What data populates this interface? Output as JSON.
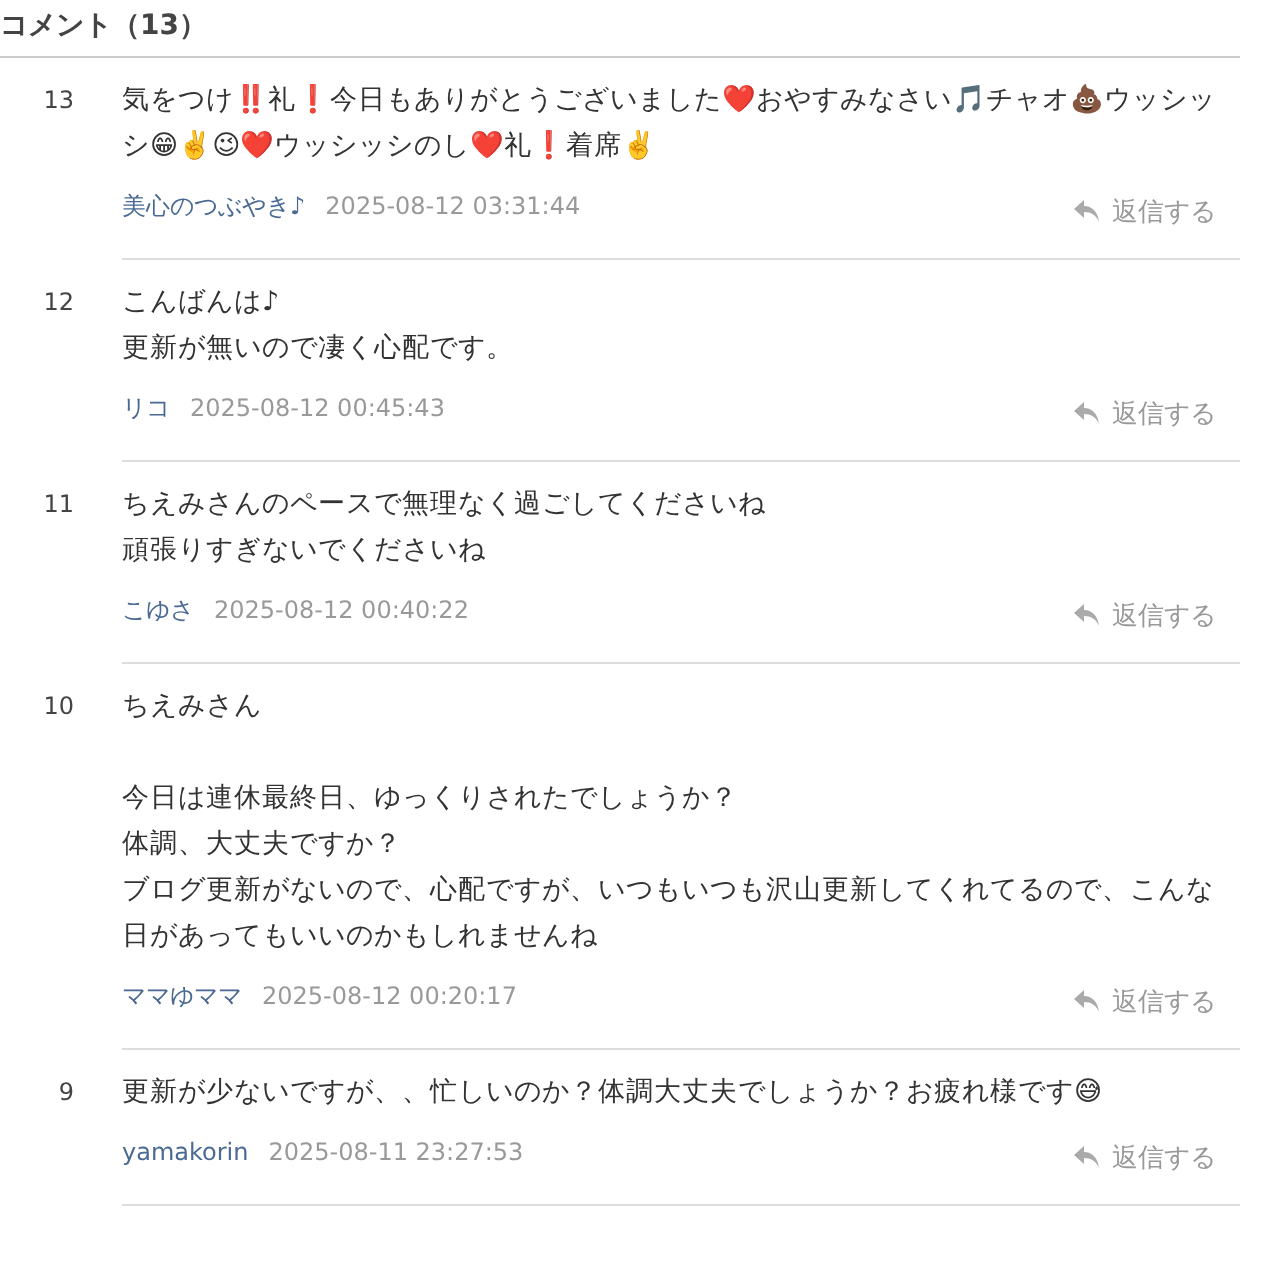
{
  "header": {
    "title": "コメント（13）"
  },
  "comments": [
    {
      "number": "13",
      "paragraphs": [
        [
          "気をつけ‼️礼❗今日もありがとうございました❤️おやすみなさい🎵チャオ💩ウッシッシ😁✌️😉❤️ウッシッシのし❤️礼❗着席✌️"
        ]
      ],
      "author": "美心のつぶやき♪",
      "date": "2025-08-12 03:31:44",
      "reply": "返信する"
    },
    {
      "number": "12",
      "paragraphs": [
        [
          "こんばんは♪",
          "更新が無いので凄く心配です。"
        ]
      ],
      "author": "リコ",
      "date": "2025-08-12 00:45:43",
      "reply": "返信する"
    },
    {
      "number": "11",
      "paragraphs": [
        [
          "ちえみさんのペースで無理なく過ごしてくださいね",
          "頑張りすぎないでくださいね"
        ]
      ],
      "author": "こゆさ",
      "date": "2025-08-12 00:40:22",
      "reply": "返信する"
    },
    {
      "number": "10",
      "paragraphs": [
        [
          "ちえみさん"
        ],
        [
          "今日は連休最終日、ゆっくりされたでしょうか？",
          "体調、大丈夫ですか？",
          "ブログ更新がないので、心配ですが、いつもいつも沢山更新してくれてるので、こんな日があってもいいのかもしれませんね"
        ]
      ],
      "author": "ママゆママ",
      "date": "2025-08-12 00:20:17",
      "reply": "返信する"
    },
    {
      "number": "9",
      "paragraphs": [
        [
          "更新が少ないですが、、忙しいのか？体調大丈夫でしょうか？お疲れ様です😅"
        ]
      ],
      "author": "yamakorin",
      "date": "2025-08-11 23:27:53",
      "reply": "返信する"
    }
  ]
}
